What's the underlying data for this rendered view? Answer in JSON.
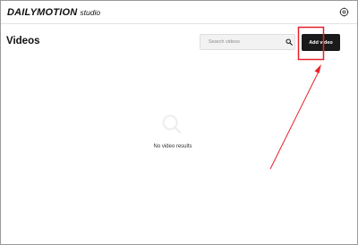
{
  "header": {
    "brand": "DAILYMOTION",
    "product": "studio",
    "settings_icon": "settings-icon"
  },
  "page": {
    "title": "Videos"
  },
  "search": {
    "placeholder": "Search videos",
    "value": "",
    "icon": "search-icon"
  },
  "actions": {
    "add_video_label": "Add video"
  },
  "empty_state": {
    "icon": "empty-search-icon",
    "message": "No video results"
  },
  "annotation": {
    "color": "#e8202a"
  }
}
